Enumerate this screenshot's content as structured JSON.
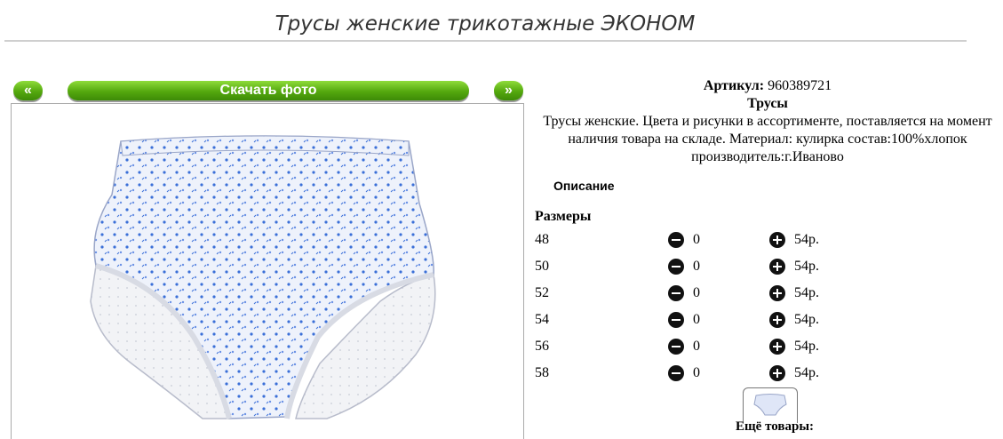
{
  "page": {
    "title": "Трусы женские трикотажные ЭКОНОМ"
  },
  "nav": {
    "prev_label": "«",
    "download_label": "Скачать фото",
    "next_label": "»"
  },
  "product": {
    "article_label": "Артикул:",
    "article_value": "960389721",
    "name": "Трусы",
    "description": "Трусы женские. Цвета и рисунки в ассортименте, поставляется на момент наличия товара на складе. Материал: кулирка состав:100%хлопок производитель:г.Иваново",
    "description_tab": "Описание",
    "sizes_header": "Размеры"
  },
  "sizes": [
    {
      "size": "48",
      "qty": "0",
      "price": "54р."
    },
    {
      "size": "50",
      "qty": "0",
      "price": "54р."
    },
    {
      "size": "52",
      "qty": "0",
      "price": "54р."
    },
    {
      "size": "54",
      "qty": "0",
      "price": "54р."
    },
    {
      "size": "56",
      "qty": "0",
      "price": "54р."
    },
    {
      "size": "58",
      "qty": "0",
      "price": "54р."
    }
  ],
  "more_goods_label": "Ещё товары:",
  "icons": {
    "minus": "minus-circle-icon",
    "plus": "plus-circle-icon"
  },
  "colors": {
    "button_green": "#54a80e",
    "pattern_blue": "#3a6fd8"
  }
}
